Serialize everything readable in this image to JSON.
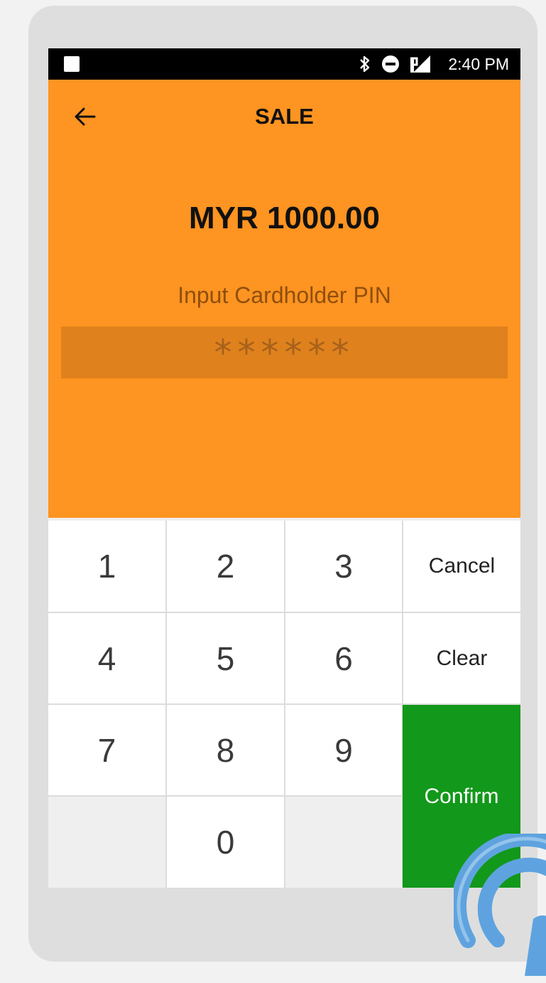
{
  "status_bar": {
    "time": "2:40 PM",
    "icons": [
      "notification-square-icon",
      "bluetooth-icon",
      "do-not-disturb-icon",
      "no-sim-signal-icon"
    ]
  },
  "header": {
    "title": "SALE"
  },
  "transaction": {
    "amount": "MYR 1000.00"
  },
  "pin_entry": {
    "label": "Input Cardholder PIN",
    "masked_value": "******"
  },
  "keypad": {
    "digits": [
      "1",
      "2",
      "3",
      "4",
      "5",
      "6",
      "7",
      "8",
      "9",
      "0"
    ],
    "cancel_label": "Cancel",
    "clear_label": "Clear",
    "confirm_label": "Confirm"
  },
  "colors": {
    "accent": "#fe9421",
    "pin_field": "#df811d",
    "confirm": "#12981a",
    "nfc": "#5ea3df"
  }
}
